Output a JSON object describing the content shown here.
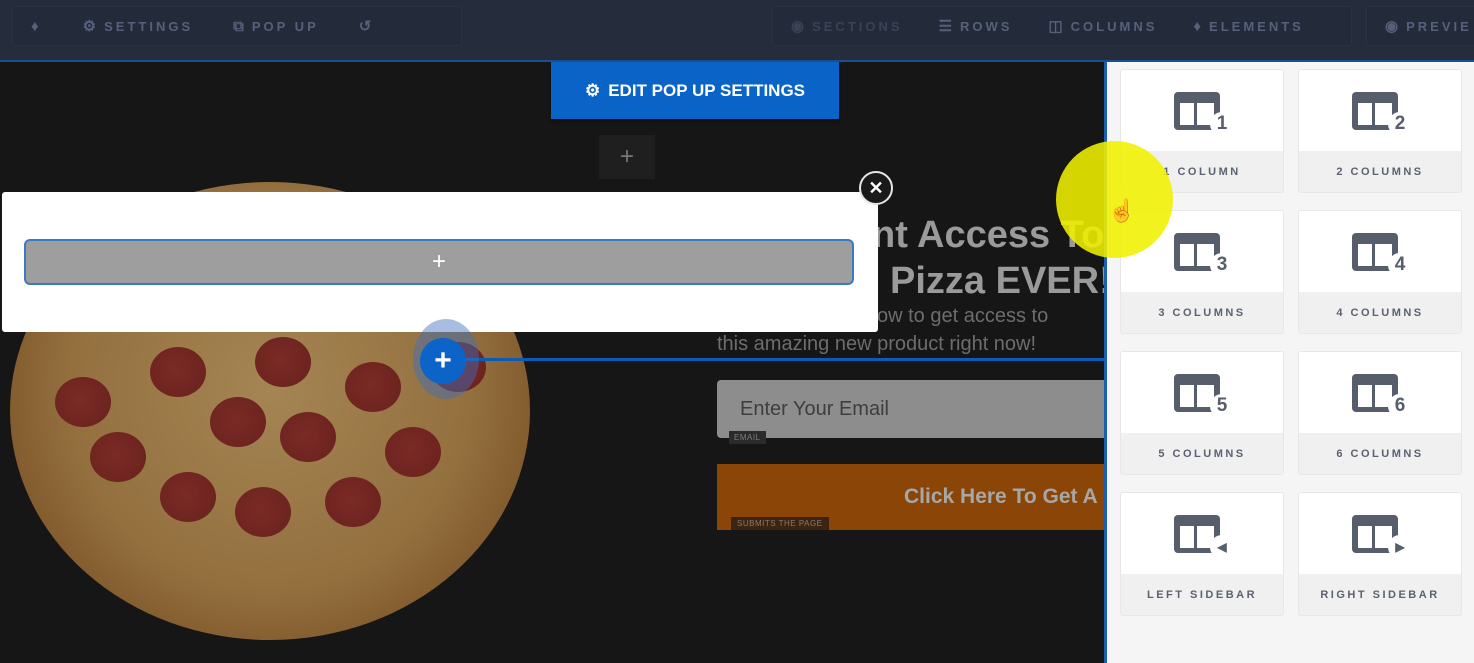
{
  "topbar": {
    "left": [
      {
        "icon": "flame-icon",
        "glyph": "♦",
        "label": ""
      },
      {
        "icon": "gears-icon",
        "glyph": "⚙",
        "label": "SETTINGS"
      },
      {
        "icon": "popup-icon",
        "glyph": "⧉",
        "label": "POP UP"
      },
      {
        "icon": "undo-icon",
        "glyph": "↺",
        "label": ""
      }
    ],
    "right": [
      {
        "icon": "sections-icon",
        "glyph": "◉",
        "label": "SECTIONS"
      },
      {
        "icon": "rows-icon",
        "glyph": "☰",
        "label": "ROWS"
      },
      {
        "icon": "columns-icon",
        "glyph": "◫",
        "label": "COLUMNS"
      },
      {
        "icon": "elements-icon",
        "glyph": "♦",
        "label": "ELEMENTS"
      },
      {
        "icon": "eye-icon",
        "glyph": "◉",
        "label": "PREVIE"
      }
    ]
  },
  "canvas": {
    "edit_popup_button": {
      "icon": "⚙",
      "label": "EDIT POP UP SETTINGS"
    },
    "add_section_glyph": "+",
    "headline_line1": "nt Access To",
    "headline_line2": "Pizza EVER!",
    "subtext_line1": "ow to get access to",
    "subtext_line2": "this amazing new product right now!",
    "email_placeholder": "Enter Your Email",
    "email_tag": "EMAIL",
    "cta_label": "Click Here To Get A",
    "cta_tag": "SUBMITS THE PAGE",
    "row_add_glyph": "+"
  },
  "popup": {
    "row_add_glyph": "+",
    "close_glyph": "✕"
  },
  "panel": {
    "cards": [
      {
        "badge": "1",
        "label": "1 COLUMN"
      },
      {
        "badge": "2",
        "label": "2 COLUMNS"
      },
      {
        "badge": "3",
        "label": "3 COLUMNS"
      },
      {
        "badge": "4",
        "label": "4 COLUMNS"
      },
      {
        "badge": "5",
        "label": "5 COLUMNS"
      },
      {
        "badge": "6",
        "label": "6 COLUMNS"
      },
      {
        "badge": "◀",
        "label": "LEFT SIDEBAR"
      },
      {
        "badge": "▶",
        "label": "RIGHT SIDEBAR"
      }
    ]
  },
  "colors": {
    "accent": "#0a63c7",
    "topbar": "#252d3d",
    "cta": "#8b4506",
    "cursor_highlight": "#f0f000"
  }
}
